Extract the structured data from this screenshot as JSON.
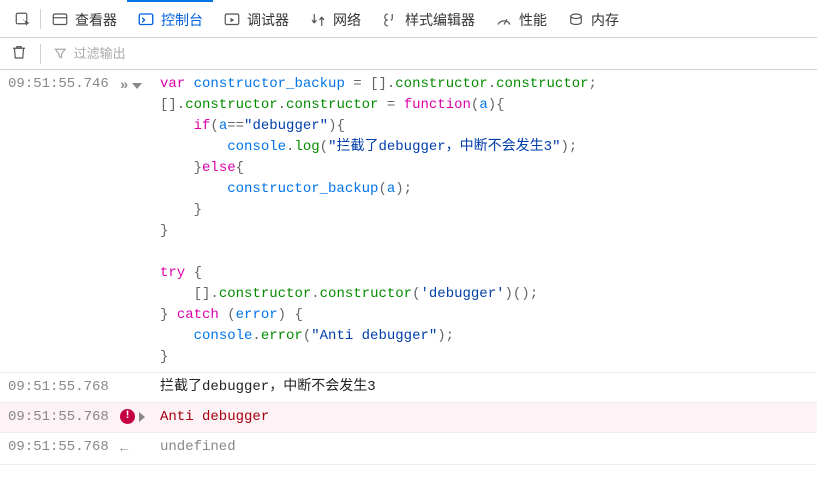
{
  "toolbar": {
    "tabs": {
      "inspector": "查看器",
      "console": "控制台",
      "debugger": "调试器",
      "network": "网络",
      "style_editor": "样式编辑器",
      "performance": "性能",
      "memory": "内存"
    }
  },
  "filter": {
    "placeholder": "过滤输出"
  },
  "rows": {
    "input": {
      "time": "09:51:55.746"
    },
    "log1": {
      "time": "09:51:55.768",
      "text": "拦截了debugger，中断不会发生3"
    },
    "error1": {
      "time": "09:51:55.768",
      "text": "Anti debugger"
    },
    "result1": {
      "time": "09:51:55.768",
      "text": "undefined"
    }
  },
  "code": {
    "l1_kw": "var",
    "l1_v1": "constructor_backup",
    "l1_p1": " = [].",
    "l1_c1": "constructor",
    "l1_p2": ".",
    "l1_c2": "constructor",
    "l1_p3": ";",
    "l2_p1": "[].",
    "l2_c1": "constructor",
    "l2_p2": ".",
    "l2_c2": "constructor",
    "l2_p3": " = ",
    "l2_fn": "function",
    "l2_p4": "(",
    "l2_a": "a",
    "l2_p5": "){",
    "l3_if": "if",
    "l3_p1": "(",
    "l3_a": "a",
    "l3_p2": "==",
    "l3_s": "\"debugger\"",
    "l3_p3": "){",
    "l4_obj": "console",
    "l4_p1": ".",
    "l4_m": "log",
    "l4_p2": "(",
    "l4_s": "\"拦截了debugger，中断不会发生3\"",
    "l4_p3": ");",
    "l5_p1": "}",
    "l5_else": "else",
    "l5_p2": "{",
    "l6_fn": "constructor_backup",
    "l6_p1": "(",
    "l6_a": "a",
    "l6_p2": ");",
    "l7": "}",
    "l8": "}",
    "l10_try": "try",
    "l10_p": " {",
    "l11_p1": "[].",
    "l11_c1": "constructor",
    "l11_p2": ".",
    "l11_c2": "constructor",
    "l11_p3": "(",
    "l11_s": "'debugger'",
    "l11_p4": ")();",
    "l12_p1": "} ",
    "l12_catch": "catch",
    "l12_p2": " (",
    "l12_e": "error",
    "l12_p3": ") {",
    "l13_obj": "console",
    "l13_p1": ".",
    "l13_m": "error",
    "l13_p2": "(",
    "l13_s": "\"Anti debugger\"",
    "l13_p3": ");",
    "l14": "}"
  }
}
